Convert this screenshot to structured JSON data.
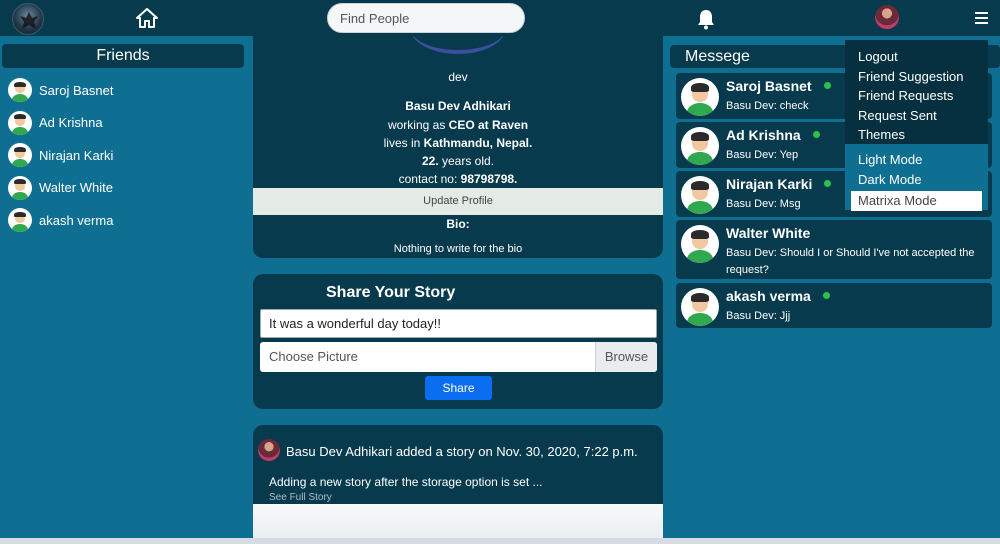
{
  "nav": {
    "search_placeholder": "Find People"
  },
  "friends": {
    "title": "Friends",
    "items": [
      {
        "name": "Saroj Basnet"
      },
      {
        "name": "Ad Krishna"
      },
      {
        "name": "Nirajan Karki"
      },
      {
        "name": "Walter White"
      },
      {
        "name": "akash verma"
      }
    ]
  },
  "profile": {
    "username": "dev",
    "full_name": "Basu Dev Adhikari",
    "work_prefix": "working as",
    "work": "CEO at Raven",
    "lives_prefix": "lives in",
    "location": "Kathmandu, Nepal.",
    "age": "22.",
    "age_suffix": "years old.",
    "contact_prefix": "contact no:",
    "contact": "98798798.",
    "update_label": "Update Profile",
    "bio_label": "Bio:",
    "bio_text": "Nothing to write for the bio"
  },
  "story": {
    "title": "Share Your Story",
    "text_value": "It was a wonderful day today!!",
    "picture_placeholder": "Choose Picture",
    "browse_label": "Browse",
    "share_label": "Share"
  },
  "post": {
    "header": "Basu Dev Adhikari added a story on Nov. 30, 2020, 7:22 p.m.",
    "text": "Adding a new story after the storage option is set ...",
    "see_full": "See Full Story"
  },
  "messages": {
    "title": "Messege",
    "items": [
      {
        "name": "Saroj Basnet",
        "text": "Basu Dev: check",
        "online": true
      },
      {
        "name": "Ad Krishna",
        "text": "Basu Dev: Yep",
        "online": true
      },
      {
        "name": "Nirajan Karki",
        "text": "Basu Dev: Msg",
        "online": true
      },
      {
        "name": "Walter White",
        "text": "Basu Dev: Should I or Should I've not accepted the request?",
        "online": false
      },
      {
        "name": "akash verma",
        "text": "Basu Dev: Jjj",
        "online": true
      }
    ]
  },
  "menu": {
    "items": [
      "Logout",
      "Friend Suggestion",
      "Friend Requests",
      "Request Sent",
      "Themes"
    ],
    "themes": [
      "Light Mode",
      "Dark Mode",
      "Matrixa Mode"
    ]
  },
  "colors": {
    "background": "#0f6f93",
    "panel": "#083a4d",
    "online": "#2bc24a",
    "primary_button": "#0b6ef0"
  }
}
